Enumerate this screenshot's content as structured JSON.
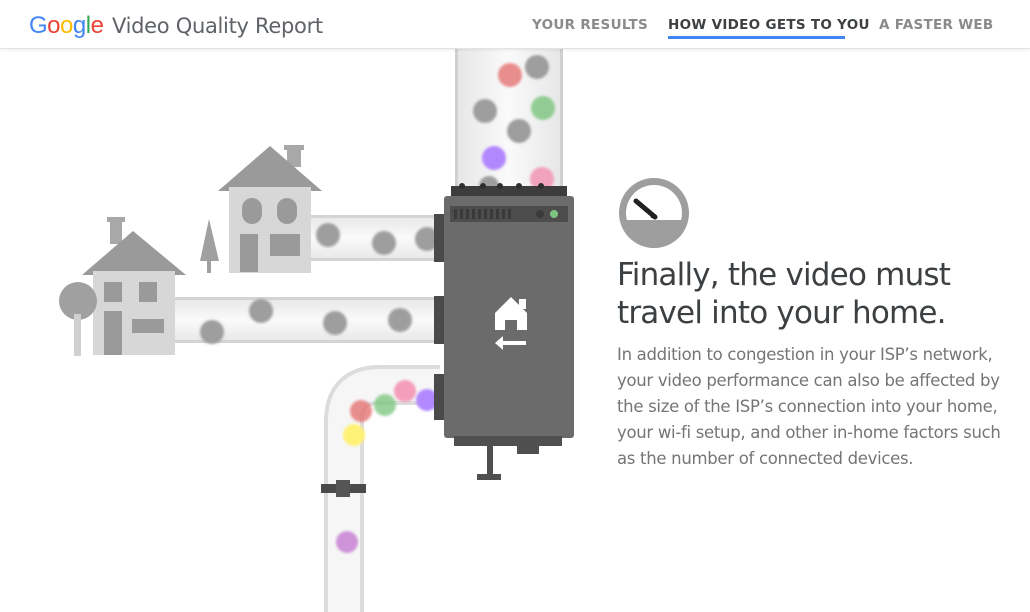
{
  "header": {
    "logo_letters": [
      {
        "char": "G",
        "color": "#4285F4"
      },
      {
        "char": "o",
        "color": "#EA4335"
      },
      {
        "char": "o",
        "color": "#FBBC05"
      },
      {
        "char": "g",
        "color": "#4285F4"
      },
      {
        "char": "l",
        "color": "#34A853"
      },
      {
        "char": "e",
        "color": "#EA4335"
      }
    ],
    "product_name": "Video Quality Report",
    "nav": [
      {
        "label": "YOUR RESULTS",
        "active": false
      },
      {
        "label": "HOW VIDEO GETS TO YOU",
        "active": true
      },
      {
        "label": "A FASTER WEB",
        "active": false
      }
    ],
    "accent_color": "#4285f4"
  },
  "content": {
    "headline": "Finally, the video must travel into your home.",
    "body": "In addition to congestion in your ISP’s network, your video performance can also be affected by the size of the ISP’s connection into your home, your wi-fi setup, and other in-home factors such as the number of connected devices."
  },
  "illustration": {
    "icon": "gauge-icon",
    "router_icon": "home-arrow-icon",
    "packet_colors": [
      "#9e9e9e",
      "#e57373",
      "#81c784",
      "#b388ff",
      "#f48fb1",
      "#fff176",
      "#ce93d8"
    ]
  }
}
